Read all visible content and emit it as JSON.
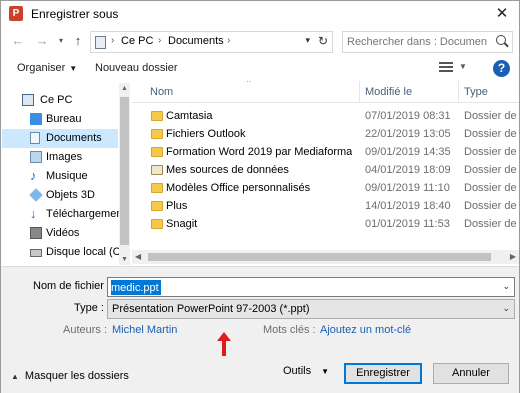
{
  "window": {
    "title": "Enregistrer sous",
    "app_icon": "P"
  },
  "nav": {
    "back_icon": "←",
    "forward_icon": "→",
    "recent_icon": "⌄",
    "up_icon": "↑",
    "breadcrumb": [
      "Ce PC",
      "Documents"
    ],
    "search_placeholder": "Rechercher dans : Documents"
  },
  "toolbar": {
    "organize_label": "Organiser",
    "new_folder_label": "Nouveau dossier"
  },
  "sidebar": {
    "items": [
      {
        "label": "Ce PC",
        "icon": "pc-icon"
      },
      {
        "label": "Bureau",
        "icon": "desktop-icon"
      },
      {
        "label": "Documents",
        "icon": "documents-icon",
        "selected": true
      },
      {
        "label": "Images",
        "icon": "images-icon"
      },
      {
        "label": "Musique",
        "icon": "music-icon"
      },
      {
        "label": "Objets 3D",
        "icon": "3d-objects-icon"
      },
      {
        "label": "Téléchargement",
        "icon": "download-icon"
      },
      {
        "label": "Vidéos",
        "icon": "videos-icon"
      },
      {
        "label": "Disque local (C:)",
        "icon": "disk-icon"
      }
    ]
  },
  "files": {
    "columns": {
      "name": "Nom",
      "modified": "Modifié le",
      "type": "Type"
    },
    "rows": [
      {
        "name": "Camtasia",
        "modified": "07/01/2019 08:31",
        "type": "Dossier de fic",
        "icon": "folder-icon"
      },
      {
        "name": "Fichiers Outlook",
        "modified": "22/01/2019 13:05",
        "type": "Dossier de fic",
        "icon": "folder-icon"
      },
      {
        "name": "Formation Word 2019 par Mediaforma_fi...",
        "modified": "09/01/2019 14:35",
        "type": "Dossier de fic",
        "icon": "folder-icon"
      },
      {
        "name": "Mes sources de données",
        "modified": "04/01/2019 18:09",
        "type": "Dossier de fic",
        "icon": "data-sources-folder-icon"
      },
      {
        "name": "Modèles Office personnalisés",
        "modified": "09/01/2019 11:10",
        "type": "Dossier de fic",
        "icon": "folder-icon"
      },
      {
        "name": "Plus",
        "modified": "14/01/2019 18:40",
        "type": "Dossier de fic",
        "icon": "folder-icon"
      },
      {
        "name": "Snagit",
        "modified": "01/01/2019 11:53",
        "type": "Dossier de fic",
        "icon": "folder-icon"
      }
    ]
  },
  "form": {
    "filename_label": "Nom de fichier :",
    "filename_value": "medic.ppt",
    "type_label": "Type :",
    "type_value": "Présentation PowerPoint 97-2003 (*.ppt)",
    "authors_label": "Auteurs :",
    "authors_value": "Michel Martin",
    "tags_label": "Mots clés :",
    "tags_value": "Ajoutez un mot-clé"
  },
  "footer": {
    "hide_folders_label": "Masquer les dossiers",
    "tools_label": "Outils",
    "save_label": "Enregistrer",
    "cancel_label": "Annuler"
  },
  "colors": {
    "accent": "#0078d7",
    "selection": "#cce8ff",
    "annotation_arrow": "#e01b1b"
  }
}
